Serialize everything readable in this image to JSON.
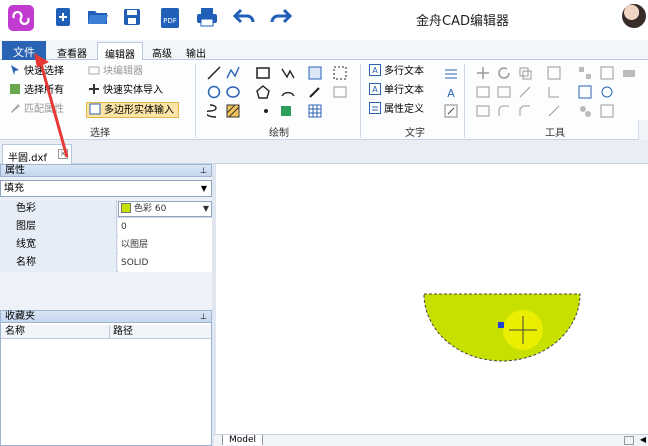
{
  "app": {
    "title": "金舟CAD编辑器"
  },
  "icons": {
    "logo": "app-logo-icon",
    "quick_access": [
      "new-file-icon",
      "open-folder-icon",
      "save-icon",
      "pdf-icon",
      "print-icon",
      "undo-icon",
      "redo-icon"
    ]
  },
  "menu_tabs": {
    "file": "文件",
    "viewer": "查看器",
    "editor": "编辑器",
    "advanced": "高级",
    "output": "输出"
  },
  "ribbon": {
    "select_group": {
      "label": "选择",
      "quick_select": "快速选择",
      "select_all": "选择所有",
      "match_props": "匹配属性",
      "block_editor": "块编辑器",
      "quick_import": "快速实体导入",
      "polygon_input": "多边形实体输入"
    },
    "draw_group": {
      "label": "绘制"
    },
    "text_group": {
      "label": "文字",
      "mtext": "多行文本",
      "text": "单行文本",
      "attdef": "属性定义"
    },
    "tools_group": {
      "label": "工具"
    }
  },
  "document": {
    "tab": "半圆.dxf"
  },
  "properties": {
    "title": "属性",
    "selected_type": "填充",
    "rows": [
      {
        "name": "色彩",
        "value": "色彩 60"
      },
      {
        "name": "图层",
        "value": "0"
      },
      {
        "name": "线宽",
        "value": "以图层"
      },
      {
        "name": "名称",
        "value": "SOLID"
      }
    ]
  },
  "favorites": {
    "title": "收藏夹",
    "columns": [
      "名称",
      "路径"
    ]
  },
  "layout_tab": "Model",
  "colors": {
    "file_tab": "#2b63b4",
    "hatch_fill": "#c8e000",
    "arrow": "#e53935"
  }
}
